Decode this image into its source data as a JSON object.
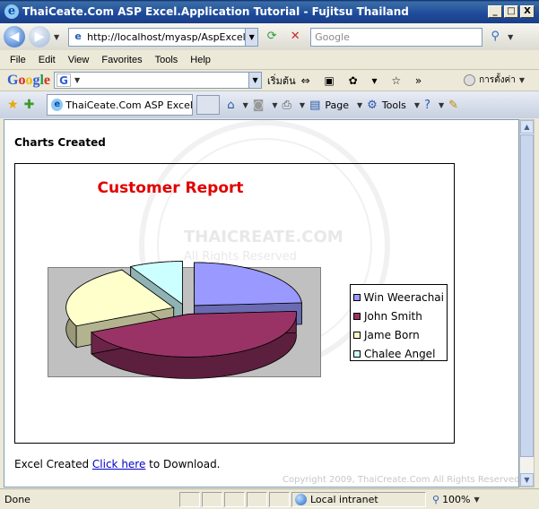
{
  "window": {
    "title": "ThaiCeate.Com ASP Excel.Application Tutorial - Fujitsu Thailand",
    "minimize_label": "_",
    "maximize_label": "□",
    "close_label": "X"
  },
  "address_bar": {
    "url": "http://localhost/myasp/AspExcelCha",
    "search_placeholder": "Google"
  },
  "menu": {
    "items": [
      "File",
      "Edit",
      "View",
      "Favorites",
      "Tools",
      "Help"
    ]
  },
  "google_toolbar": {
    "search_button": "เริ่มต้น",
    "settings_label": "การตั้งค่า"
  },
  "tabs": {
    "active_label": "ThaiCeate.Com ASP Excel...",
    "page_label": "Page",
    "tools_label": "Tools"
  },
  "page": {
    "heading": "Charts Created",
    "footer_prefix": "Excel Created ",
    "footer_link": "Click here",
    "footer_suffix": " to Download.",
    "copyright": "Copyright 2009, ThaiCreate.Com All Rights Reserved."
  },
  "chart_data": {
    "type": "pie",
    "title": "Customer Report",
    "legend_position": "right",
    "series": [
      {
        "name": "Win Weerachai",
        "color": "#9999ff"
      },
      {
        "name": "John Smith",
        "color": "#993366"
      },
      {
        "name": "Jame Born",
        "color": "#ffffcc"
      },
      {
        "name": "Chalee Angel",
        "color": "#ccffff"
      }
    ],
    "values": [
      24,
      44,
      24,
      8
    ]
  },
  "status_bar": {
    "status": "Done",
    "zone": "Local intranet",
    "zoom": "100%"
  }
}
